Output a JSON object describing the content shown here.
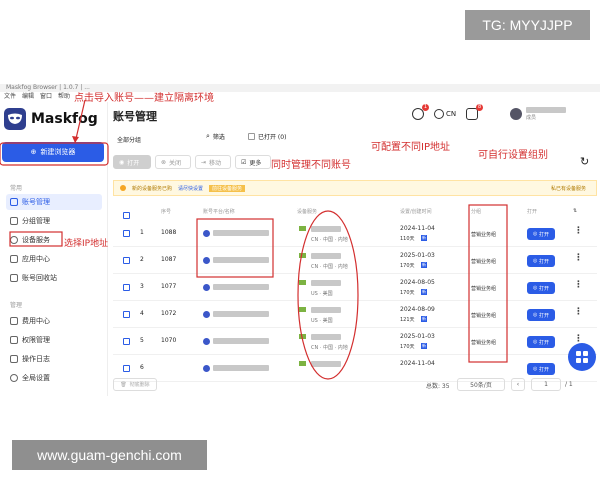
{
  "watermark": {
    "tg": "TG: MYYJJPP",
    "site": "www.guam-genchi.com"
  },
  "window": {
    "title": "Maskfog Browser | 1.0.7 | ...",
    "menu": [
      "文件",
      "编辑",
      "窗口",
      "帮助"
    ]
  },
  "brand": {
    "name": "Maskfog",
    "logo_color": "#2f3f8f"
  },
  "sidebar": {
    "new_button": "新建浏览器",
    "section_1": "常用",
    "items_1": [
      {
        "label": "账号管理",
        "icon": "folder-icon"
      },
      {
        "label": "分组管理",
        "icon": "group-icon"
      },
      {
        "label": "设备服务",
        "icon": "location-icon"
      },
      {
        "label": "应用中心",
        "icon": "app-icon"
      },
      {
        "label": "账号回收站",
        "icon": "trash-icon"
      }
    ],
    "section_2": "管理",
    "items_2": [
      {
        "label": "费用中心",
        "icon": "wallet-icon"
      },
      {
        "label": "权限管理",
        "icon": "shield-icon"
      },
      {
        "label": "操作日志",
        "icon": "log-icon"
      },
      {
        "label": "全局设置",
        "icon": "gear-icon"
      }
    ]
  },
  "header": {
    "title": "账号管理",
    "badge_1": "1",
    "lang": "CN",
    "badge_2": "8",
    "user_role": "成员"
  },
  "filters": {
    "group": "全部分组",
    "filter": "筛选",
    "opened": "已打开 (0)"
  },
  "toolbar": {
    "open": "打开",
    "close": "关闭",
    "move": "移动",
    "more": "更多"
  },
  "notice": {
    "text": "新的设备服务已购",
    "link": "请尽快设置",
    "highlight": "前往设备服务",
    "right": "私已有设备服务"
  },
  "table": {
    "headers": [
      "序号",
      "账号平台/名称",
      "设备服务",
      "设置/创建时间",
      "分组",
      "打开"
    ],
    "rows": [
      {
        "idx": "1",
        "seq": "1088",
        "geo": "CN · 中国 · 内地",
        "date": "2024-11-04",
        "days": "110天",
        "group": "营销业务组"
      },
      {
        "idx": "2",
        "seq": "1087",
        "geo": "CN · 中国 · 内地",
        "date": "2025-01-03",
        "days": "170天",
        "group": "营销业务组"
      },
      {
        "idx": "3",
        "seq": "1077",
        "geo": "US · 美国",
        "date": "2024-08-05",
        "days": "170天",
        "group": "营销业务组"
      },
      {
        "idx": "4",
        "seq": "1072",
        "geo": "US · 美国",
        "date": "2024-08-09",
        "days": "121天",
        "group": "营销业务组"
      },
      {
        "idx": "5",
        "seq": "1070",
        "geo": "CN · 中国 · 内地",
        "date": "2025-01-03",
        "days": "170天",
        "group": "营销业务组"
      },
      {
        "idx": "6",
        "seq": "",
        "geo": "",
        "date": "2024-11-04",
        "days": "",
        "group": ""
      }
    ],
    "new_tag": "新",
    "open_label": "打开"
  },
  "footer": {
    "delete": "彻底删除",
    "total": "总数: 35",
    "per_page": "50条/页",
    "page": "1",
    "pages": "/ 1"
  },
  "annotations": {
    "a1": "点击导入账号——建立隔离环境",
    "a2": "同时管理不同账号",
    "a3": "可配置不同IP地址",
    "a4": "可自行设置组别",
    "a5": "选择IP地址"
  },
  "colors": {
    "primary": "#2b5ce6",
    "annotation": "#d32f2f"
  }
}
